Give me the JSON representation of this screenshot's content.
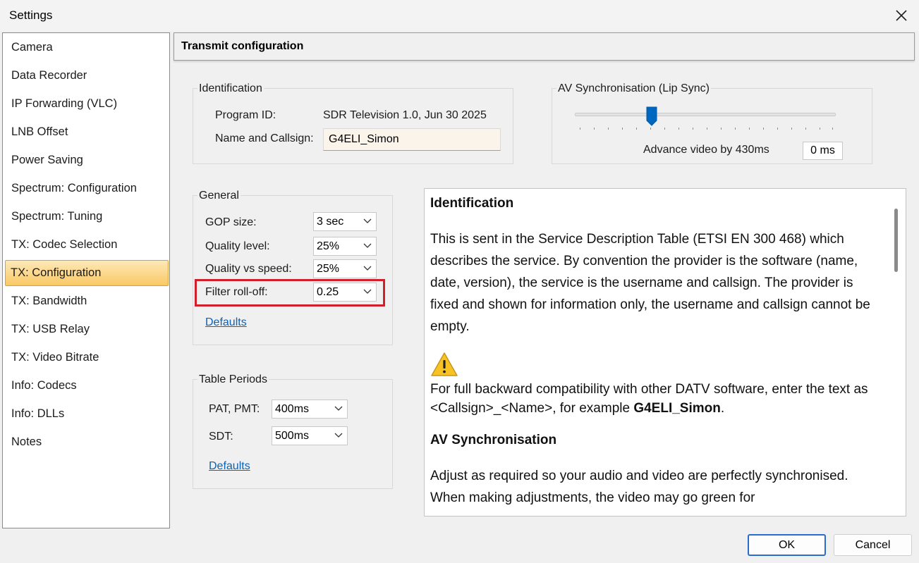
{
  "window": {
    "title": "Settings"
  },
  "sidebar": {
    "items": [
      {
        "label": "Camera"
      },
      {
        "label": "Data Recorder"
      },
      {
        "label": "IP Forwarding (VLC)"
      },
      {
        "label": "LNB Offset"
      },
      {
        "label": "Power Saving"
      },
      {
        "label": "Spectrum: Configuration"
      },
      {
        "label": "Spectrum: Tuning"
      },
      {
        "label": "TX: Codec Selection"
      },
      {
        "label": "TX: Configuration",
        "selected": true
      },
      {
        "label": "TX: Bandwidth"
      },
      {
        "label": "TX: USB Relay"
      },
      {
        "label": "TX: Video Bitrate"
      },
      {
        "label": "Info: Codecs"
      },
      {
        "label": "Info: DLLs"
      },
      {
        "label": "Notes"
      }
    ]
  },
  "header": {
    "title": "Transmit configuration"
  },
  "identification": {
    "group_label": "Identification",
    "program_id_label": "Program ID:",
    "program_id_value": "SDR Television 1.0, Jun 30 2025",
    "callsign_label": "Name and Callsign:",
    "callsign_value": "G4ELI_Simon"
  },
  "av_sync": {
    "group_label": "AV Synchronisation (Lip Sync)",
    "advance_text": "Advance video by 430ms",
    "offset_value": "0 ms",
    "slider_fraction": 0.29
  },
  "general": {
    "group_label": "General",
    "gop_label": "GOP size:",
    "gop_value": "3 sec",
    "quality_label": "Quality level:",
    "quality_value": "25%",
    "qvs_label": "Quality vs speed:",
    "qvs_value": "25%",
    "rolloff_label": "Filter roll-off:",
    "rolloff_value": "0.25",
    "defaults_link": "Defaults"
  },
  "table_periods": {
    "group_label": "Table Periods",
    "pat_label": "PAT, PMT:",
    "pat_value": "400ms",
    "sdt_label": "SDT:",
    "sdt_value": "500ms",
    "defaults_link": "Defaults"
  },
  "help": {
    "heading1": "Identification",
    "para1": "This is sent in the Service Description Table (ETSI EN 300 468) which describes the service. By convention the provider is the software (name, date, version), the service is the username and callsign. The provider is fixed and shown for information only, the username and callsign cannot be empty.",
    "warning_pre": "For full backward compatibility with other DATV software, enter the text as <Callsign>_<Name>, for example ",
    "warning_bold": "G4ELI_Simon",
    "warning_post": ".",
    "heading2": "AV Synchronisation",
    "para2": "Adjust as required so your audio and video are perfectly synchronised. When making adjustments, the video may go green for"
  },
  "buttons": {
    "ok": "OK",
    "cancel": "Cancel"
  },
  "colors": {
    "selection": "#f9c964",
    "highlight_box": "#d1202b",
    "link": "#0b62b6",
    "slider_thumb": "#0067c0",
    "default_button_border": "#2a6bd1"
  }
}
